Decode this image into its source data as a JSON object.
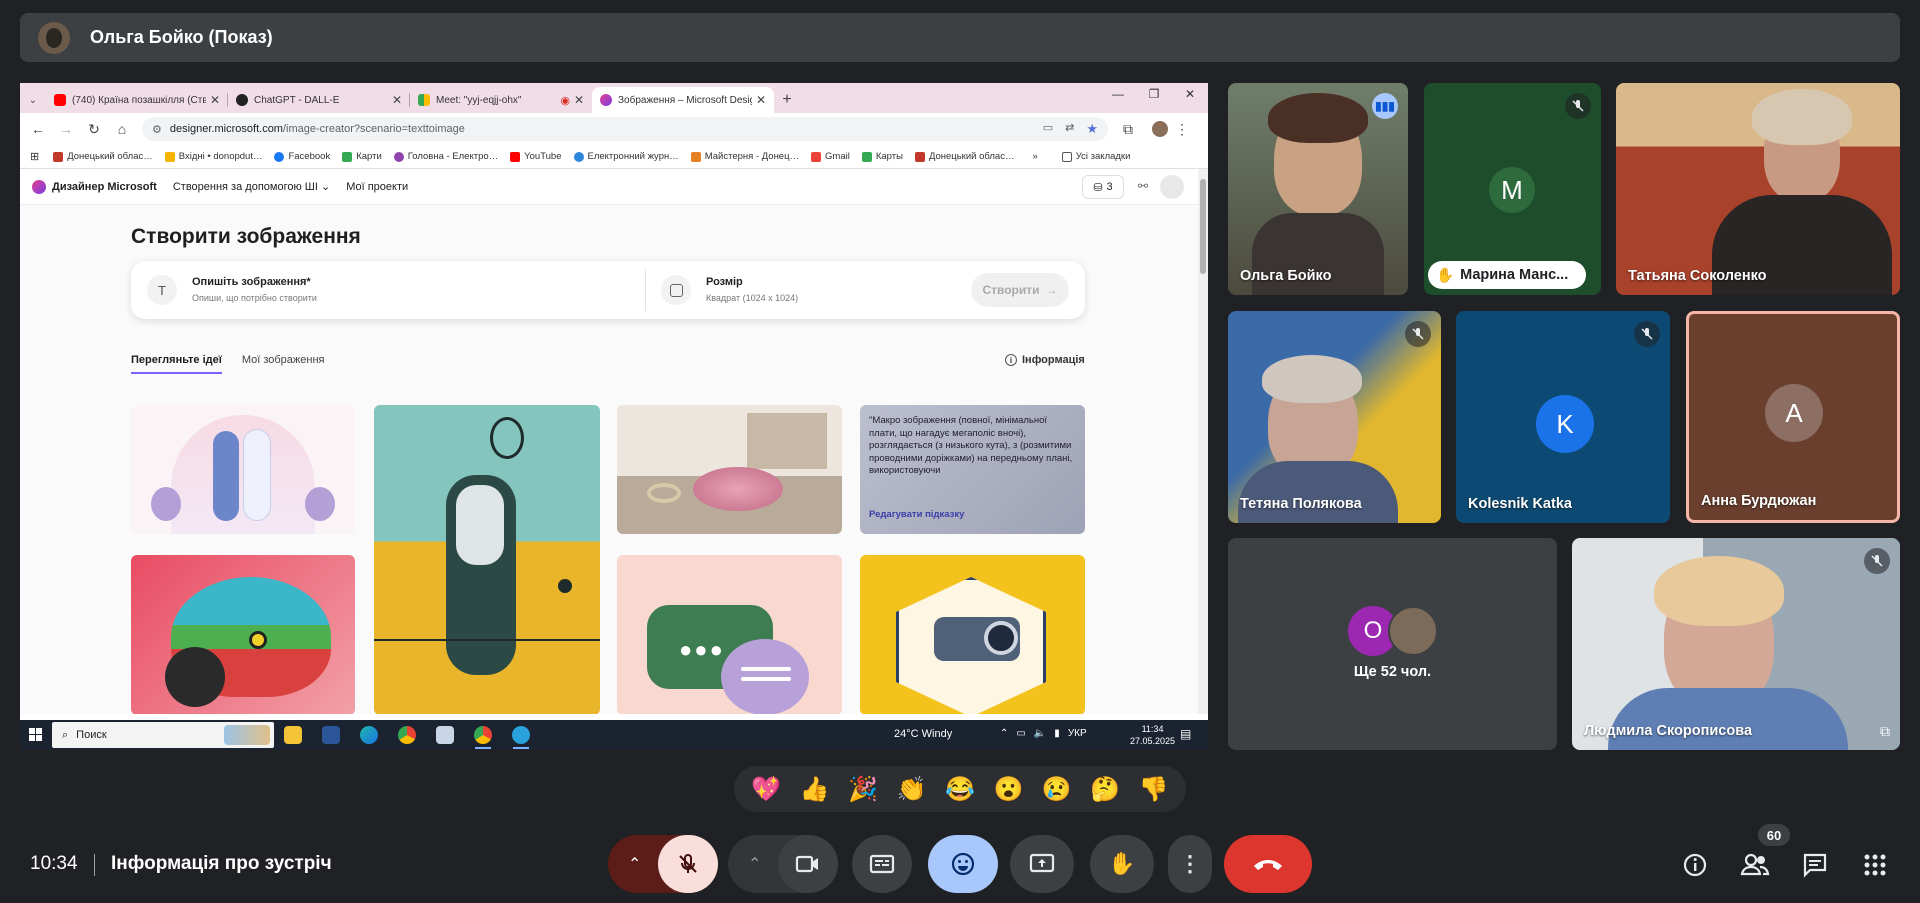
{
  "presenter": {
    "name": "Ольга Бойко (Показ)"
  },
  "browser": {
    "tabs": [
      {
        "title": "(740) Країна позашкілля (Ство",
        "color": "#ff0000"
      },
      {
        "title": "ChatGPT - DALL-E",
        "color": "#222222"
      },
      {
        "title": "Meet: \"yyj-eqjj-ohx\"",
        "color": "#34a853"
      },
      {
        "title": "Зображення – Microsoft Desig",
        "color": "#7b3fe4"
      }
    ],
    "url_host": "designer.microsoft.com",
    "url_path": "/image-creator?scenario=texttoimage",
    "bookmarks": [
      {
        "label": "Донецький облас…",
        "color": "#c0392b"
      },
      {
        "label": "Вхідні • donopdut…",
        "color": "#f4b400"
      },
      {
        "label": "Facebook",
        "color": "#1877f2"
      },
      {
        "label": "Карти",
        "color": "#34a853"
      },
      {
        "label": "Головна - Електро…",
        "color": "#8e44ad"
      },
      {
        "label": "YouTube",
        "color": "#ff0000"
      },
      {
        "label": "Електронний журн…",
        "color": "#2e86de"
      },
      {
        "label": "Майстерня - Донец…",
        "color": "#e67e22"
      },
      {
        "label": "Gmail",
        "color": "#ea4335"
      },
      {
        "label": "Карты",
        "color": "#34a853"
      },
      {
        "label": "Донецький облас…",
        "color": "#c0392b"
      }
    ],
    "bookmarks_more": "»",
    "all_bookmarks": "Усі закладки"
  },
  "designer": {
    "brand": "Дизайнер Microsoft",
    "nav_create": "Створення за допомогою ШІ",
    "nav_projects": "Мої проекти",
    "credits": "3",
    "title": "Створити зображення",
    "prompt_label": "Опишіть зображення*",
    "prompt_hint": "Опиши, що потрібно створити",
    "size_label": "Розмір",
    "size_value": "Квадрат (1024 x 1024)",
    "create_button": "Створити",
    "tab_ideas": "Перегляньте ідеї",
    "tab_my_images": "Мої зображення",
    "info": "Інформація",
    "idea_prompt_text": "\"Макро зображення (повної, мінімальної плати, що нагадує мегаполіс вночі), розглядається (з низького кута), з (розмитими проводними доріжками) на передньому плані, використовуючи",
    "idea_edit": "Редагувати підказку"
  },
  "taskbar": {
    "search": "Поиск",
    "weather": "24°C  Windy",
    "lang": "УКР",
    "time": "11:34",
    "date": "27.05.2025"
  },
  "participants": [
    {
      "name": "Ольга Бойко"
    },
    {
      "name": "Марина Манс...",
      "initial": "M"
    },
    {
      "name": "Татьяна Соколенко"
    },
    {
      "name": "Тетяна Полякова"
    },
    {
      "name": "Kolesnik Katka",
      "initial": "K"
    },
    {
      "name": "Анна Бурдюжан",
      "initial": "A"
    },
    {
      "name": "Людмила Скорописова"
    }
  ],
  "more_tile": {
    "initial": "O",
    "label": "Ще 52 чол."
  },
  "reactions": [
    "💖",
    "👍",
    "🎉",
    "👏",
    "😂",
    "😮",
    "😢",
    "🤔",
    "👎"
  ],
  "bottom": {
    "clock": "10:34",
    "meeting_info": "Інформація про зустріч",
    "participant_count": "60"
  },
  "colors": {
    "background": "#202124",
    "accent_blue": "#a8c7fa",
    "end_call": "#dc362e",
    "mic_off_bg": "#f9dedc"
  }
}
